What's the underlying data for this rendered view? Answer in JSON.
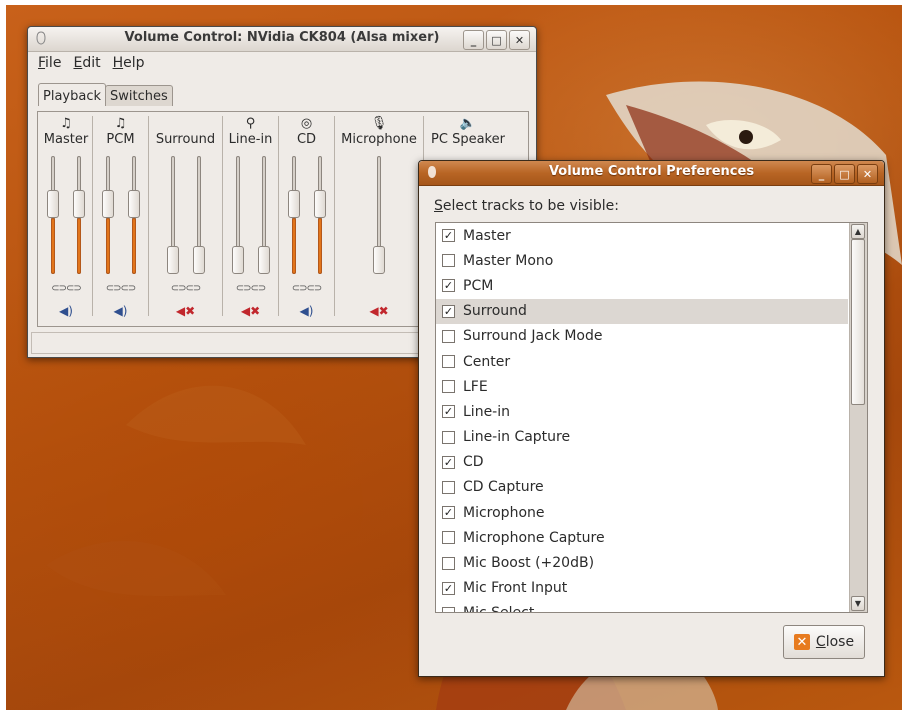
{
  "main_window": {
    "title": "Volume Control: NVidia CK804 (Alsa mixer)",
    "menu": [
      {
        "accel": "F",
        "rest": "ile"
      },
      {
        "accel": "E",
        "rest": "dit"
      },
      {
        "accel": "H",
        "rest": "elp"
      }
    ],
    "tabs": [
      "Playback",
      "Switches"
    ],
    "active_tab": "Playback",
    "tracks": [
      {
        "name": "Master",
        "icon": "music-note-icon",
        "glyph": "♫",
        "channels": [
          0.62,
          0.62
        ],
        "muted": false
      },
      {
        "name": "PCM",
        "icon": "music-note-icon",
        "glyph": "♫",
        "channels": [
          0.62,
          0.62
        ],
        "muted": false
      },
      {
        "name": "Surround",
        "icon": "",
        "glyph": "",
        "channels": [
          0.0,
          0.0
        ],
        "muted": true
      },
      {
        "name": "Line-in",
        "icon": "line-in-icon",
        "glyph": "⚲",
        "channels": [
          0.0,
          0.0
        ],
        "muted": true
      },
      {
        "name": "CD",
        "icon": "cd-icon",
        "glyph": "◎",
        "channels": [
          0.62,
          0.62
        ],
        "muted": false
      },
      {
        "name": "Microphone",
        "icon": "microphone-icon",
        "glyph": "🎙",
        "channels": [
          0.0
        ],
        "muted": true
      },
      {
        "name": "PC Speaker",
        "icon": "speaker-icon",
        "glyph": "🔈",
        "channels": [],
        "muted": false
      }
    ]
  },
  "prefs_window": {
    "title": "Volume Control Preferences",
    "label_accel": "S",
    "label_rest": "elect tracks to be visible:",
    "items": [
      {
        "label": "Master",
        "checked": true
      },
      {
        "label": "Master Mono",
        "checked": false
      },
      {
        "label": "PCM",
        "checked": true
      },
      {
        "label": "Surround",
        "checked": true,
        "selected": true
      },
      {
        "label": "Surround Jack Mode",
        "checked": false
      },
      {
        "label": "Center",
        "checked": false
      },
      {
        "label": "LFE",
        "checked": false
      },
      {
        "label": "Line-in",
        "checked": true
      },
      {
        "label": "Line-in Capture",
        "checked": false
      },
      {
        "label": "CD",
        "checked": true
      },
      {
        "label": "CD Capture",
        "checked": false
      },
      {
        "label": "Microphone",
        "checked": true
      },
      {
        "label": "Microphone Capture",
        "checked": false
      },
      {
        "label": "Mic Boost (+20dB)",
        "checked": false
      },
      {
        "label": "Mic Front Input",
        "checked": true
      },
      {
        "label": "Mic Select",
        "checked": false
      }
    ],
    "close_accel": "C",
    "close_rest": "lose"
  },
  "colors": {
    "accent": "#e2751b",
    "title_active": "#b86524",
    "mute": "#c1272d"
  }
}
